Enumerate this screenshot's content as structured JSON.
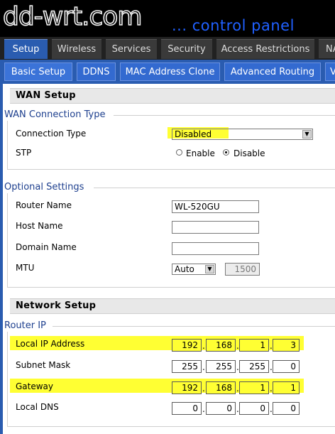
{
  "header": {
    "logo": "dd-wrt.com",
    "subtitle": "... control panel"
  },
  "main_tabs": [
    "Setup",
    "Wireless",
    "Services",
    "Security",
    "Access Restrictions",
    "NA"
  ],
  "sub_tabs": [
    "Basic Setup",
    "DDNS",
    "MAC Address Clone",
    "Advanced Routing",
    "V"
  ],
  "wan": {
    "section_title": "WAN Setup",
    "legend": "WAN Connection Type",
    "connection_type_label": "Connection Type",
    "connection_type_value": "Disabled",
    "stp_label": "STP",
    "stp_enable": "Enable",
    "stp_disable": "Disable",
    "stp_selected": "Disable"
  },
  "optional": {
    "legend": "Optional Settings",
    "router_name_label": "Router Name",
    "router_name_value": "WL-520GU",
    "host_name_label": "Host Name",
    "host_name_value": "",
    "domain_name_label": "Domain Name",
    "domain_name_value": "",
    "mtu_label": "MTU",
    "mtu_mode": "Auto",
    "mtu_value": "1500"
  },
  "network": {
    "section_title": "Network Setup",
    "legend": "Router IP",
    "local_ip_label": "Local IP Address",
    "local_ip": [
      "192",
      "168",
      "1",
      "3"
    ],
    "subnet_label": "Subnet Mask",
    "subnet": [
      "255",
      "255",
      "255",
      "0"
    ],
    "gateway_label": "Gateway",
    "gateway": [
      "192",
      "168",
      "1",
      "1"
    ],
    "dns_label": "Local DNS",
    "dns": [
      "0",
      "0",
      "0",
      "0"
    ]
  },
  "colors": {
    "highlight": "#ffff33",
    "tab_blue": "#2a5cb0",
    "legend_blue": "#1d3f8e"
  }
}
